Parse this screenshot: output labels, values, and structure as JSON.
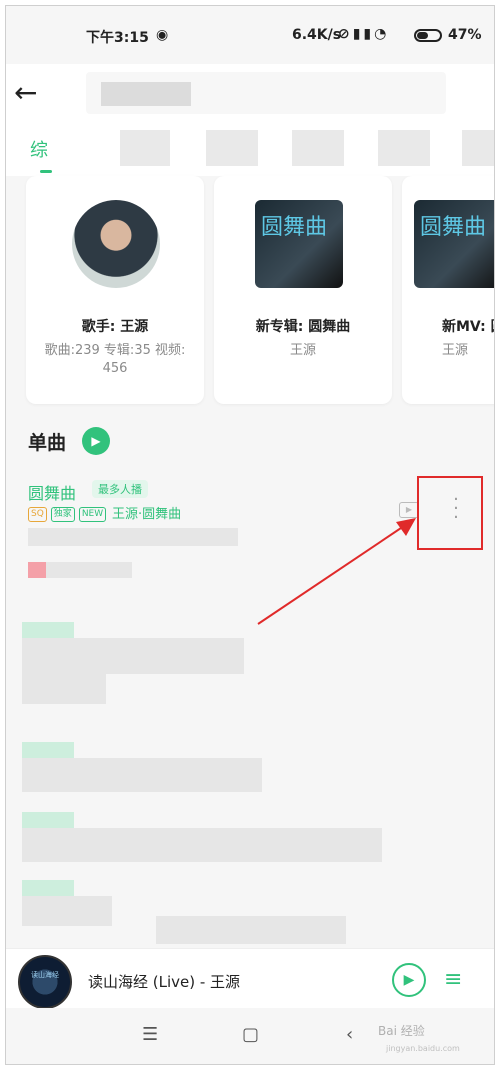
{
  "status": {
    "time": "下午3:15",
    "net_speed": "6.4K/s",
    "battery": "47%"
  },
  "tabs": {
    "active_label": "综"
  },
  "cards": [
    {
      "title": "歌手: 王源",
      "subtitle": "歌曲:239 专辑:35 视频:",
      "subtitle2": "456"
    },
    {
      "title": "新专辑: 圆舞曲",
      "subtitle": "王源",
      "cover_text": "圆舞曲"
    },
    {
      "title": "新MV: 圆",
      "subtitle": "王源",
      "cover_text": "圆舞曲"
    }
  ],
  "section": {
    "title": "单曲"
  },
  "song": {
    "title": "圆舞曲",
    "badge": "最多人播",
    "tags": [
      "SQ",
      "独家",
      "NEW"
    ],
    "artist_album": "王源·圆舞曲"
  },
  "player": {
    "now_playing": "读山海经 (Live) - 王源",
    "cover_text": "读山海经"
  },
  "watermark": {
    "text": "Bai 经验",
    "url": "jingyan.baidu.com"
  },
  "colors": {
    "accent": "#31c27c",
    "highlight": "#e02a2a"
  }
}
